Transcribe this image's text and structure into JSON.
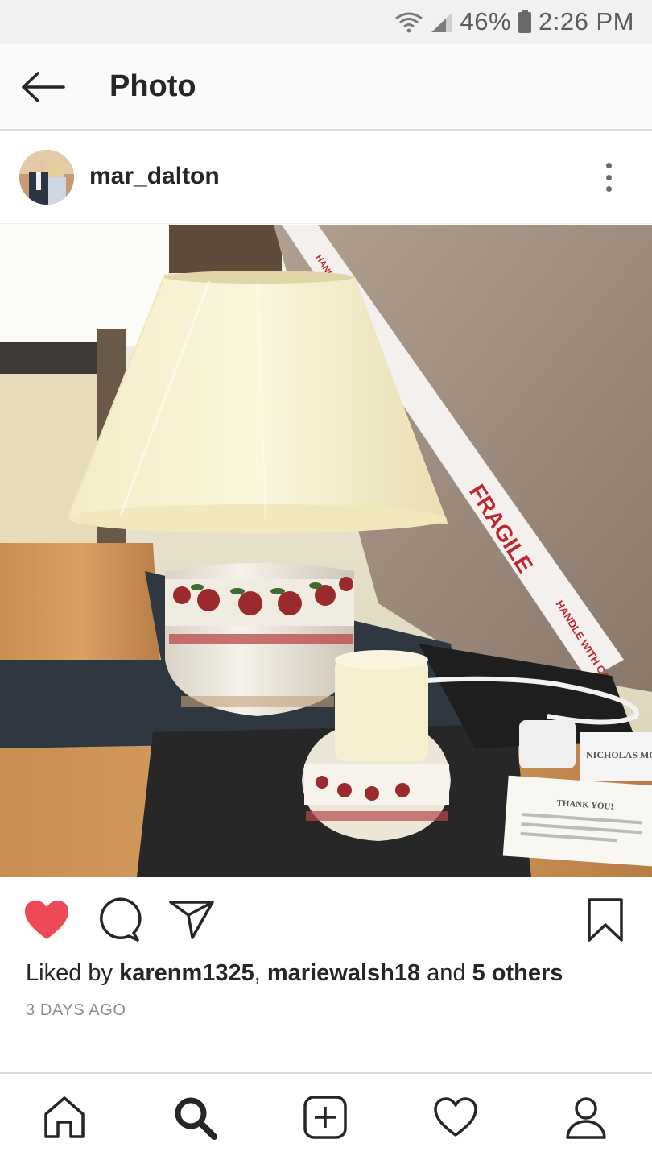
{
  "status_bar": {
    "battery": "46%",
    "time": "2:26 PM",
    "icons": [
      "wifi-icon",
      "signal-icon",
      "battery-icon"
    ]
  },
  "header": {
    "title": "Photo",
    "back_icon": "back-arrow-icon"
  },
  "post": {
    "username": "mar_dalton",
    "avatar": "avatar",
    "more_icon": "more-vertical-icon",
    "photo_label": "Post photo: table lamp with apple pattern base, candle holder, and shipping box",
    "photo_text": {
      "tape_1": "HANDLE WITH CARE",
      "tape_2": "FRAGILE",
      "tape_3": "HANDLE WITH CARE",
      "card_brand": "NICHOLAS MOSSE",
      "card_thanks": "THANK YOU!"
    },
    "liked": true,
    "likes": {
      "prefix": "Liked by ",
      "user1": "karenm1325",
      "sep": ", ",
      "user2": "mariewalsh18",
      "and": " and ",
      "others": "5 others"
    },
    "timestamp": "3 DAYS AGO"
  },
  "colors": {
    "like_red": "#ed4956",
    "text": "#262626",
    "muted": "#8e8e8e"
  },
  "bottom_nav": [
    "home-icon",
    "search-icon",
    "new-post-icon",
    "activity-icon",
    "profile-icon"
  ]
}
